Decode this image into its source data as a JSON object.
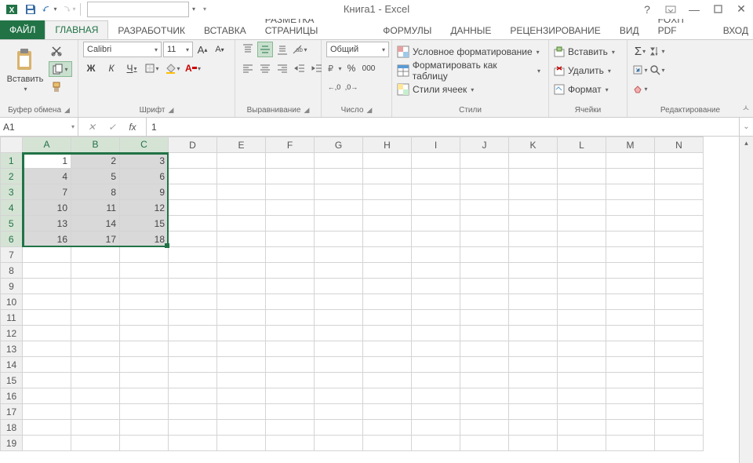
{
  "title": "Книга1 - Excel",
  "qat": {
    "name_value": ""
  },
  "tabs": {
    "file": "ФАЙЛ",
    "items": [
      "ГЛАВНАЯ",
      "Разработчик",
      "ВСТАВКА",
      "РАЗМЕТКА СТРАНИЦЫ",
      "ФОРМУЛЫ",
      "ДАННЫЕ",
      "РЕЦЕНЗИРОВАНИЕ",
      "ВИД",
      "Foxit PDF"
    ],
    "login": "Вход",
    "active_index": 0
  },
  "ribbon": {
    "clipboard": {
      "paste": "Вставить",
      "label": "Буфер обмена"
    },
    "font": {
      "name": "Calibri",
      "size": "11",
      "label": "Шрифт",
      "bold": "Ж",
      "italic": "К",
      "underline": "Ч"
    },
    "alignment": {
      "label": "Выравнивание"
    },
    "number": {
      "format": "Общий",
      "label": "Число"
    },
    "styles": {
      "cond": "Условное форматирование",
      "table": "Форматировать как таблицу",
      "cell": "Стили ячеек",
      "label": "Стили"
    },
    "cells": {
      "insert": "Вставить",
      "delete": "Удалить",
      "format": "Формат",
      "label": "Ячейки"
    },
    "editing": {
      "label": "Редактирование"
    }
  },
  "formula_bar": {
    "cell_ref": "A1",
    "value": "1"
  },
  "columns": [
    "A",
    "B",
    "C",
    "D",
    "E",
    "F",
    "G",
    "H",
    "I",
    "J",
    "K",
    "L",
    "M",
    "N"
  ],
  "rows": 19,
  "selected_cols": [
    0,
    1,
    2
  ],
  "selected_rows": [
    0,
    1,
    2,
    3,
    4,
    5
  ],
  "active_cell": {
    "r": 0,
    "c": 0
  },
  "cells": {
    "0": {
      "0": "1",
      "1": "2",
      "2": "3"
    },
    "1": {
      "0": "4",
      "1": "5",
      "2": "6"
    },
    "2": {
      "0": "7",
      "1": "8",
      "2": "9"
    },
    "3": {
      "0": "10",
      "1": "11",
      "2": "12"
    },
    "4": {
      "0": "13",
      "1": "14",
      "2": "15"
    },
    "5": {
      "0": "16",
      "1": "17",
      "2": "18"
    }
  }
}
